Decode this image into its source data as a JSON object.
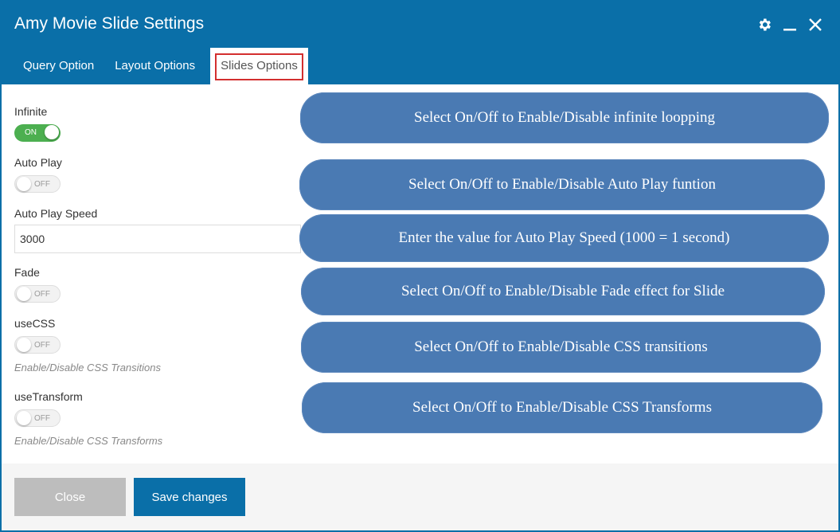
{
  "window": {
    "title": "Amy Movie Slide Settings",
    "icons": [
      "gear-icon",
      "minimize-icon",
      "close-icon"
    ]
  },
  "tabs": [
    {
      "label": "Query Option"
    },
    {
      "label": "Layout Options"
    },
    {
      "label": "Slides Options",
      "active": true
    }
  ],
  "fields": {
    "infinite": {
      "label": "Infinite",
      "state": "ON"
    },
    "auto_play": {
      "label": "Auto Play",
      "state": "OFF"
    },
    "auto_play_speed": {
      "label": "Auto Play Speed",
      "value": "3000"
    },
    "fade": {
      "label": "Fade",
      "state": "OFF"
    },
    "use_css": {
      "label": "useCSS",
      "state": "OFF",
      "help": "Enable/Disable CSS Transitions"
    },
    "use_transform": {
      "label": "useTransform",
      "state": "OFF",
      "help": "Enable/Disable CSS Transforms"
    }
  },
  "annotations": [
    "Select On/Off to Enable/Disable infinite loopping",
    "Select On/Off to Enable/Disable Auto Play funtion",
    "Enter the value for Auto Play Speed (1000 = 1 second)",
    "Select On/Off to Enable/Disable Fade effect for Slide",
    "Select On/Off to Enable/Disable CSS transitions",
    "Select On/Off to Enable/Disable CSS Transforms"
  ],
  "footer": {
    "close_label": "Close",
    "save_label": "Save changes"
  },
  "colors": {
    "header": "#0a6fa8",
    "toggle_on": "#4caf50",
    "annotation": "#4a7ab3",
    "highlight": "#d32f2f"
  }
}
